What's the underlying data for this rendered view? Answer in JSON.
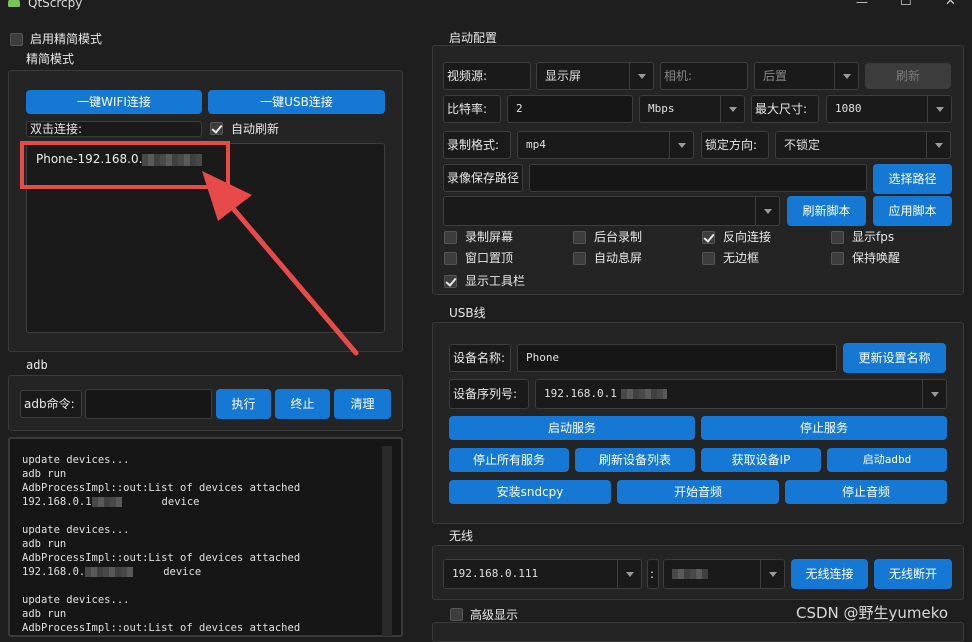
{
  "window": {
    "title": "QtScrcpy",
    "minimize": "—",
    "maximize": "☐",
    "close": "✕"
  },
  "left": {
    "simple_mode_toggle": "启用精简模式",
    "simple_group_title": "精简模式",
    "wifi_button": "一键WIFI连接",
    "usb_button": "一键USB连接",
    "double_click_label": "双击连接:",
    "auto_refresh_label": "自动刷新",
    "device_item": "Phone-192.168.0.",
    "adb_group_title": "adb",
    "adb_cmd_label": "adb命令:",
    "adb_cmd_value": "",
    "execute_button": "执行",
    "stop_button": "终止",
    "clear_button": "清理",
    "log": [
      {
        "text": "update devices..."
      },
      {
        "text": "adb run"
      },
      {
        "text": "AdbProcessImpl::out:List of devices attached"
      },
      {
        "text": "192.168.0.1",
        "tail": "device"
      },
      {
        "text": ""
      },
      {
        "text": "update devices..."
      },
      {
        "text": "adb run"
      },
      {
        "text": "AdbProcessImpl::out:List of devices attached"
      },
      {
        "text": "192.168.0.",
        "tail": "device"
      },
      {
        "text": ""
      },
      {
        "text": "update devices..."
      },
      {
        "text": "adb run"
      },
      {
        "text": "AdbProcessImpl::out:List of devices attached"
      }
    ]
  },
  "startup": {
    "group_title": "启动配置",
    "video_source_label": "视频源:",
    "video_source_value": "显示屏",
    "camera_label": "相机:",
    "camera_position_value": "后置",
    "refresh_button": "刷新",
    "bitrate_label": "比特率:",
    "bitrate_value": "2",
    "bitrate_unit": "Mbps",
    "max_size_label": "最大尺寸:",
    "max_size_value": "1080",
    "record_format_label": "录制格式:",
    "record_format_value": "mp4",
    "lock_orientation_label": "锁定方向:",
    "lock_orientation_value": "不锁定",
    "record_path_label": "录像保存路径",
    "record_path_value": "",
    "select_path_button": "选择路径",
    "script_value": "",
    "refresh_script_button": "刷新脚本",
    "apply_script_button": "应用脚本",
    "options": [
      {
        "label": "录制屏幕",
        "checked": false
      },
      {
        "label": "后台录制",
        "checked": false
      },
      {
        "label": "反向连接",
        "checked": true
      },
      {
        "label": "显示fps",
        "checked": false
      },
      {
        "label": "窗口置顶",
        "checked": false
      },
      {
        "label": "自动息屏",
        "checked": false
      },
      {
        "label": "无边框",
        "checked": false
      },
      {
        "label": "保持唤醒",
        "checked": false
      },
      {
        "label": "显示工具栏",
        "checked": true
      }
    ]
  },
  "usb": {
    "group_title": "USB线",
    "device_name_label": "设备名称:",
    "device_name_value": "Phone",
    "update_name_button": "更新设置名称",
    "serial_label": "设备序列号:",
    "serial_value": "192.168.0.1",
    "start_service_button": "启动服务",
    "stop_service_button": "停止服务",
    "stop_all_button": "停止所有服务",
    "refresh_devices_button": "刷新设备列表",
    "get_ip_button": "获取设备IP",
    "start_adbd_button": "启动adbd",
    "install_sndcpy_button": "安装sndcpy",
    "start_audio_button": "开始音频",
    "stop_audio_button": "停止音频"
  },
  "wireless": {
    "group_title": "无线",
    "ip_value": "192.168.0.111",
    "separator": ":",
    "connect_button": "无线连接",
    "disconnect_button": "无线断开"
  },
  "advanced": {
    "title": "高级显示"
  },
  "watermark": "CSDN @野生yumeko",
  "colors": {
    "accent": "#1478d4",
    "annotation": "#e84a4a",
    "background": "#1e1e1e"
  }
}
